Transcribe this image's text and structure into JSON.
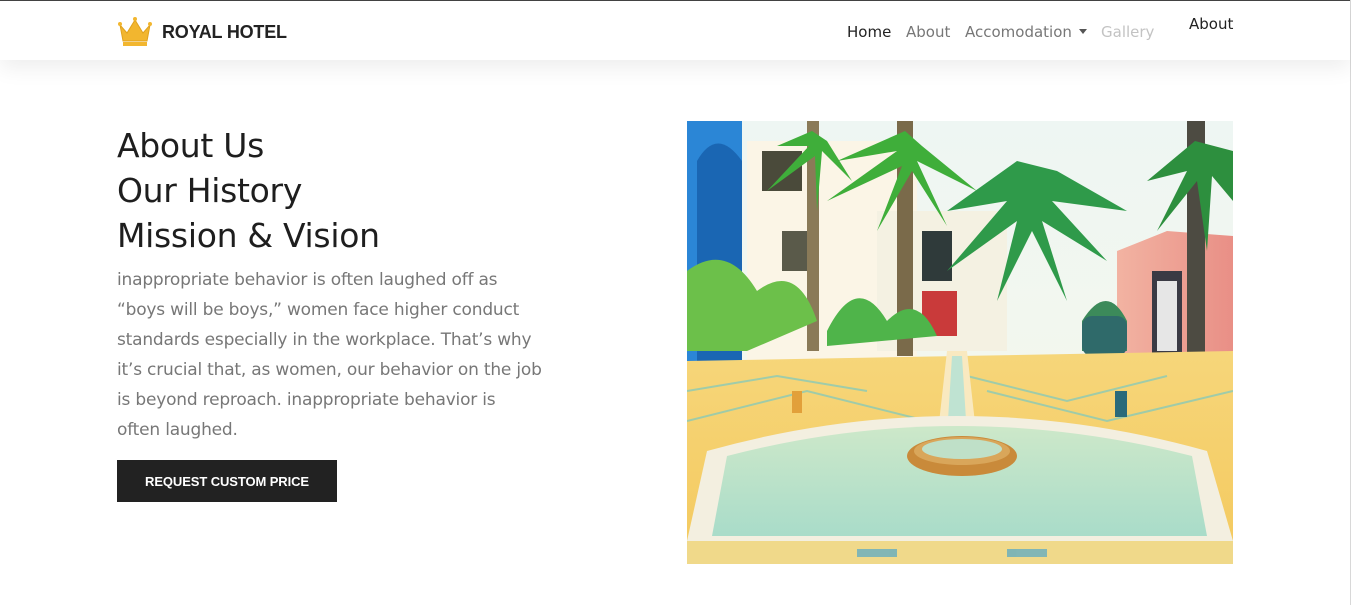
{
  "brand": {
    "name": "ROYAL HOTEL",
    "logo_icon": "crown-icon",
    "logo_color": "#f2b62f"
  },
  "nav": {
    "home": "Home",
    "about": "About",
    "accommodation": "Accomodation",
    "gallery": "Gallery",
    "about_right": "About"
  },
  "hero": {
    "title_lines": [
      "About Us",
      "Our History",
      "Mission & Vision"
    ],
    "description_lines": [
      "inappropriate behavior is often laughed off as",
      "“boys will be boys,” women face higher conduct",
      "standards especially in the workplace. That’s why",
      "it’s crucial that, as women, our behavior on the job",
      "is beyond reproach. inappropriate behavior is",
      "often laughed."
    ],
    "cta_label": "REQUEST CUSTOM PRICE"
  },
  "colors": {
    "text_dark": "#1e1e1e",
    "text_muted": "#777777",
    "button_bg": "#222222"
  }
}
